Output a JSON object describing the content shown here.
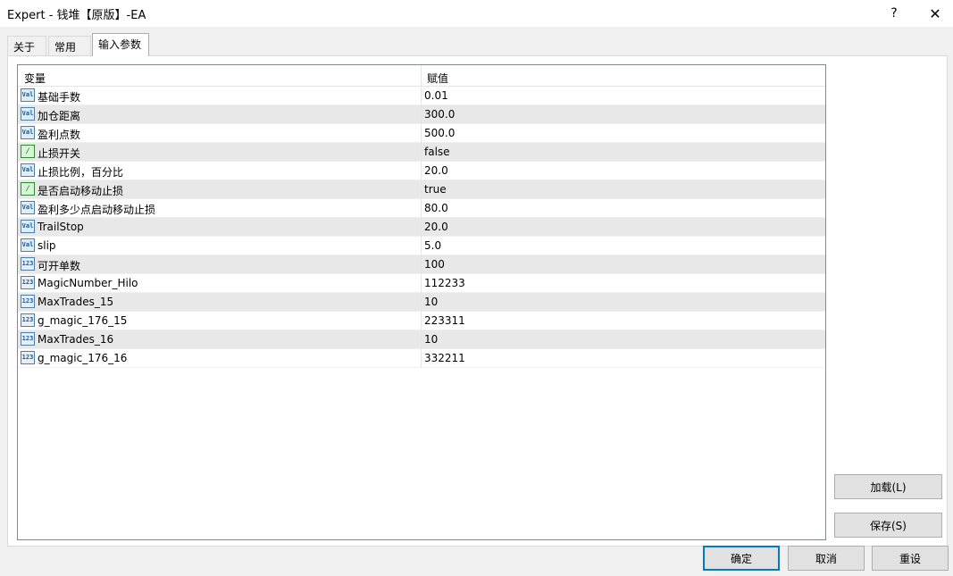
{
  "window": {
    "title": "Expert - 钱堆【原版】-EA",
    "help": "?",
    "close": "✕"
  },
  "tabs": [
    {
      "label": "关于"
    },
    {
      "label": "常用"
    },
    {
      "label": "输入参数"
    }
  ],
  "grid": {
    "headers": {
      "variable": "变量",
      "value": "赋值"
    },
    "rows": [
      {
        "icon": "double-value-icon",
        "glyph": "Val",
        "name": "基础手数",
        "value": "0.01"
      },
      {
        "icon": "double-value-icon",
        "glyph": "Val",
        "name": "加仓距离",
        "value": "300.0"
      },
      {
        "icon": "double-value-icon",
        "glyph": "Val",
        "name": "盈利点数",
        "value": "500.0"
      },
      {
        "icon": "bool-value-icon",
        "glyph": "⁄",
        "name": "止损开关",
        "value": "false"
      },
      {
        "icon": "double-value-icon",
        "glyph": "Val",
        "name": "止损比例，百分比",
        "value": "20.0"
      },
      {
        "icon": "bool-value-icon",
        "glyph": "⁄",
        "name": "是否启动移动止损",
        "value": "true"
      },
      {
        "icon": "double-value-icon",
        "glyph": "Val",
        "name": "盈利多少点启动移动止损",
        "value": "80.0"
      },
      {
        "icon": "double-value-icon",
        "glyph": "Val",
        "name": "TrailStop",
        "value": "20.0"
      },
      {
        "icon": "double-value-icon",
        "glyph": "Val",
        "name": "slip",
        "value": "5.0"
      },
      {
        "icon": "int-value-icon",
        "glyph": "123",
        "name": "可开单数",
        "value": "100"
      },
      {
        "icon": "int-value-icon",
        "glyph": "123",
        "name": "MagicNumber_Hilo",
        "value": "112233"
      },
      {
        "icon": "int-value-icon",
        "glyph": "123",
        "name": "MaxTrades_15",
        "value": "10"
      },
      {
        "icon": "int-value-icon",
        "glyph": "123",
        "name": "g_magic_176_15",
        "value": "223311"
      },
      {
        "icon": "int-value-icon",
        "glyph": "123",
        "name": "MaxTrades_16",
        "value": "10"
      },
      {
        "icon": "int-value-icon",
        "glyph": "123",
        "name": "g_magic_176_16",
        "value": "332211"
      }
    ]
  },
  "buttons": {
    "load": "加载(L)",
    "save": "保存(S)",
    "ok": "确定",
    "cancel": "取消",
    "reset": "重设"
  }
}
